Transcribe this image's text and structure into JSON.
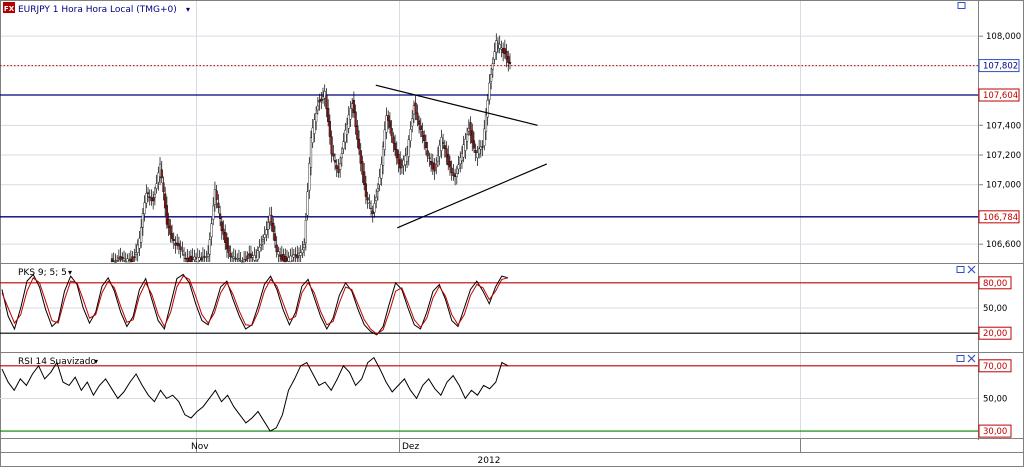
{
  "header": {
    "symbol_badge": "FX",
    "title": "EURJPY 1 Hora Hora Local (TMG+0)",
    "dropdown_glyph": "▾"
  },
  "colors": {
    "blue_line": "#000080",
    "red": "#c00000",
    "green": "#008000",
    "candle_body": "#8b1a1a",
    "grid": "#d6dce6"
  },
  "icons": [
    "maximize-icon",
    "close-icon",
    "dropdown-icon"
  ],
  "chart_data": [
    {
      "type": "candlestick",
      "title": "EURJPY 1 Hora Hora Local (TMG+0)",
      "price_axis_ticks": [
        "108,000",
        "107,400",
        "107,200",
        "107,000",
        "106,600"
      ],
      "current_price_label": "107,802",
      "horizontal_levels": [
        {
          "label": "107,604",
          "value": 107.604
        },
        {
          "label": "106,784",
          "value": 106.784
        }
      ],
      "current_price": 107.802,
      "ylim": [
        106.48,
        108.23
      ],
      "trendlines": [
        {
          "from": [
            0.367,
            107.67
          ],
          "to": [
            0.525,
            107.4
          ]
        },
        {
          "from": [
            0.388,
            106.71
          ],
          "to": [
            0.534,
            107.14
          ]
        }
      ],
      "close_series": [
        106.5,
        106.5,
        106.48,
        106.5,
        106.62,
        106.95,
        106.9,
        107.12,
        106.75,
        106.62,
        106.55,
        106.5,
        106.5,
        106.49,
        106.55,
        106.95,
        106.7,
        106.55,
        106.48,
        106.5,
        106.52,
        106.5,
        106.65,
        106.78,
        106.55,
        106.5,
        106.5,
        106.52,
        106.6,
        107.3,
        107.55,
        107.62,
        107.2,
        107.1,
        107.35,
        107.55,
        107.25,
        106.9,
        106.82,
        107.05,
        107.45,
        107.3,
        107.1,
        107.2,
        107.55,
        107.35,
        107.2,
        107.1,
        107.3,
        107.15,
        107.05,
        107.2,
        107.4,
        107.2,
        107.25,
        107.7,
        107.95,
        107.9,
        107.82
      ]
    },
    {
      "type": "line",
      "name": "PKS 9; 5; 5",
      "level_labels": [
        "80,00",
        "50,00",
        "20,00"
      ],
      "levels": [
        80,
        50,
        20
      ],
      "ylim": [
        0,
        100
      ],
      "series": [
        {
          "color": "#000000",
          "values": [
            72,
            40,
            25,
            50,
            82,
            90,
            75,
            48,
            28,
            35,
            70,
            88,
            78,
            50,
            32,
            45,
            76,
            86,
            70,
            45,
            28,
            40,
            72,
            85,
            60,
            35,
            25,
            55,
            85,
            90,
            80,
            55,
            35,
            30,
            50,
            75,
            82,
            60,
            40,
            25,
            30,
            52,
            78,
            88,
            72,
            48,
            30,
            45,
            76,
            84,
            62,
            40,
            25,
            38,
            65,
            80,
            70,
            48,
            30,
            22,
            18,
            28,
            55,
            80,
            72,
            50,
            30,
            25,
            45,
            70,
            78,
            60,
            35,
            28,
            50,
            72,
            82,
            70,
            55,
            75,
            88,
            86
          ]
        },
        {
          "color": "#c00000",
          "values": [
            68,
            50,
            32,
            42,
            70,
            86,
            80,
            58,
            35,
            32,
            60,
            82,
            80,
            60,
            38,
            42,
            68,
            82,
            74,
            52,
            33,
            36,
            64,
            80,
            66,
            42,
            28,
            45,
            75,
            88,
            84,
            64,
            42,
            32,
            44,
            68,
            80,
            66,
            46,
            30,
            29,
            45,
            70,
            84,
            76,
            56,
            36,
            40,
            68,
            80,
            68,
            46,
            30,
            34,
            56,
            75,
            72,
            54,
            36,
            25,
            19,
            24,
            45,
            70,
            74,
            56,
            36,
            27,
            38,
            62,
            76,
            64,
            42,
            30,
            42,
            65,
            78,
            74,
            60,
            70,
            84,
            86
          ]
        }
      ]
    },
    {
      "type": "line",
      "name": "RSI 14 Suavizado",
      "level_labels": [
        "70,00",
        "50,00",
        "30,00"
      ],
      "levels": [
        70,
        30
      ],
      "ylim": [
        27,
        76
      ],
      "series": [
        {
          "color": "#000000",
          "values": [
            68,
            60,
            55,
            62,
            58,
            65,
            70,
            62,
            66,
            72,
            60,
            58,
            63,
            55,
            60,
            52,
            58,
            62,
            56,
            50,
            54,
            60,
            65,
            58,
            52,
            48,
            55,
            50,
            52,
            48,
            40,
            38,
            42,
            45,
            50,
            55,
            48,
            52,
            45,
            40,
            35,
            38,
            42,
            36,
            30,
            32,
            40,
            55,
            62,
            70,
            72,
            65,
            58,
            60,
            55,
            62,
            70,
            66,
            58,
            62,
            72,
            75,
            68,
            60,
            54,
            58,
            62,
            55,
            50,
            58,
            62,
            56,
            52,
            60,
            64,
            58,
            50,
            55,
            52,
            58,
            56,
            60,
            72,
            70
          ]
        }
      ]
    }
  ],
  "time_axis": {
    "labels": [
      "Nov",
      "Dez"
    ],
    "year": "2012"
  }
}
